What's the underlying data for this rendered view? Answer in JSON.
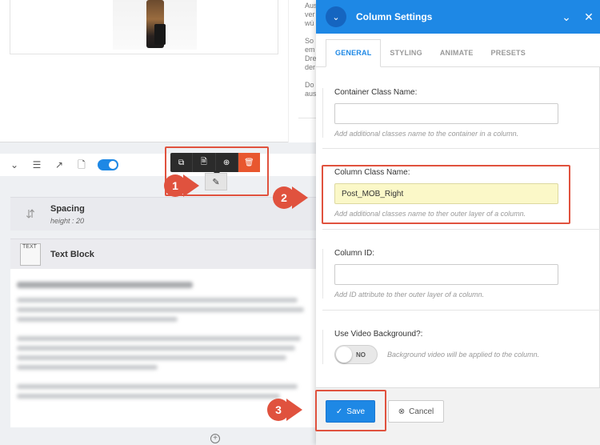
{
  "preview": {
    "side_text_lines": [
      "Aus",
      "ver",
      "wü",
      "",
      "So",
      "em",
      "Dre",
      "der",
      "",
      "Do",
      "aus"
    ]
  },
  "toolbar": {
    "icons": [
      "chevron-down-icon",
      "list-icon",
      "external-link-icon",
      "add-page-icon"
    ]
  },
  "element_actions": {
    "icons": [
      "copy-icon",
      "file-icon",
      "add-circle-icon",
      "trash-icon"
    ],
    "edit_icon": "edit-icon"
  },
  "elements": {
    "spacing": {
      "title": "Spacing",
      "subtitle": "height : 20"
    },
    "text_block": {
      "title": "Text Block",
      "icon_text": "TEXT"
    }
  },
  "modal": {
    "title": "Column Settings",
    "tabs": [
      {
        "label": "GENERAL",
        "active": true
      },
      {
        "label": "STYLING",
        "active": false
      },
      {
        "label": "ANIMATE",
        "active": false
      },
      {
        "label": "PRESETS",
        "active": false
      }
    ],
    "fields": {
      "container_class": {
        "label": "Container Class Name:",
        "value": "",
        "hint": "Add additional classes name to the container in a column."
      },
      "column_class": {
        "label": "Column Class Name:",
        "value": "Post_MOB_Right",
        "hint": "Add additional classes name to ther outer layer of a column."
      },
      "column_id": {
        "label": "Column ID:",
        "value": "",
        "hint": "Add ID attribute to ther outer layer of a column."
      },
      "video_bg": {
        "label": "Use Video Background?:",
        "toggle_text": "NO",
        "hint": "Background video will be applied to the column."
      }
    },
    "footer": {
      "save_label": "Save",
      "cancel_label": "Cancel"
    }
  },
  "callouts": [
    "1",
    "2",
    "3"
  ],
  "colors": {
    "primary": "#1e88e5",
    "danger": "#e8572f",
    "callout": "#e0523e",
    "highlight_input": "#fbf8c8"
  }
}
